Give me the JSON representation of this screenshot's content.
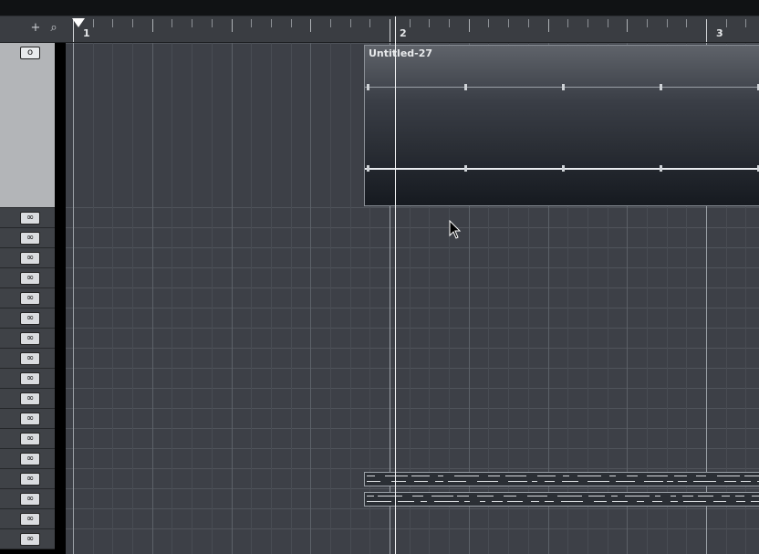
{
  "ruler": {
    "bars": [
      "1",
      "2",
      "3"
    ],
    "tools": [
      {
        "name": "add-track",
        "icon": "plus-icon",
        "glyph": "+"
      },
      {
        "name": "zoom",
        "icon": "magnifier-icon",
        "glyph": "⌕"
      }
    ]
  },
  "tracks": {
    "selected_button_glyph": "o",
    "lane_button_glyph": "∞",
    "count": 17
  },
  "part": {
    "name": "Untitled-27"
  },
  "colors": {
    "background": "#3d4047",
    "playhead": "#f2f3f4",
    "selected_track": "#b3b5b8"
  }
}
